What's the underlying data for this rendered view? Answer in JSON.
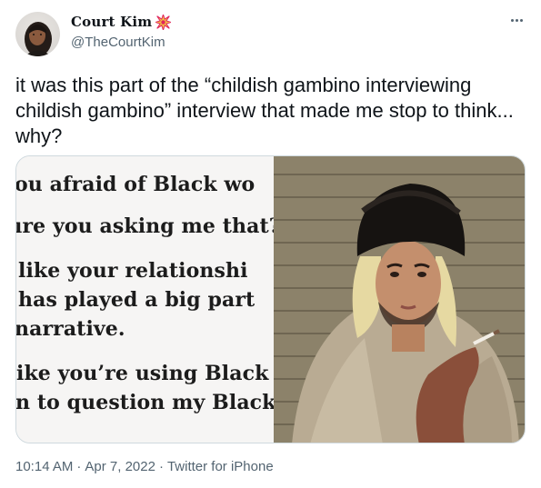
{
  "author": {
    "display_name": "Court Kim",
    "handle": "@TheCourtKim",
    "badge_icon": "burst-icon",
    "avatar_icon": "avatar"
  },
  "more_menu_icon": "more-dots-icon",
  "tweet": {
    "text": "it was this part of the “childish gambino interviewing childish gambino” interview that made me stop to think... why?"
  },
  "media": {
    "quote_lines": [
      "ou afraid of Black wo",
      "ıre you asking me that?",
      "like your relationshi",
      "has played a big part",
      "narrative.",
      "ike you’re using Black",
      "n to question my Black"
    ],
    "photo_icon": "photo"
  },
  "footer": {
    "time": "10:14 AM",
    "sep1": "·",
    "date": "Apr 7, 2022",
    "sep2": "·",
    "source": "Twitter for iPhone"
  },
  "colors": {
    "text": "#0f1419",
    "secondary": "#536471",
    "badge": "#e0245e",
    "border": "#cfd9de"
  }
}
